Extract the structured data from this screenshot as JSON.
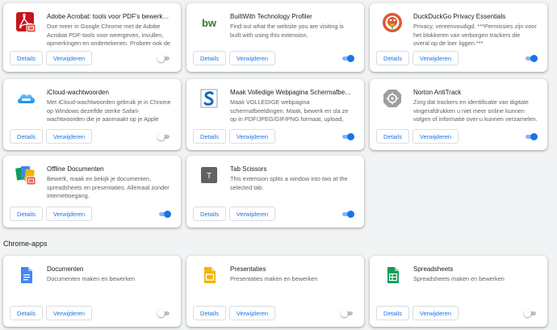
{
  "buttons": {
    "details": "Details",
    "remove": "Verwijderen"
  },
  "extensions": [
    {
      "name": "Adobe Acrobat: tools voor PDF's bewerken, co...",
      "description": "Doe meer in Google Chrome met de Adobe Acrobat PDF-tools voor weergeven, invullen, opmerkingen en ondertekenen. Probeer ook de",
      "enabled": false,
      "icon": "adobe-acrobat-icon"
    },
    {
      "name": "BuiltWith Technology Profiler",
      "description": "Find out what the website you are visiting is built with using this extension.",
      "enabled": true,
      "icon": "builtwith-icon",
      "icon_text": "bw"
    },
    {
      "name": "DuckDuckGo Privacy Essentials",
      "description": "Privacy, vereenvoudigd. ***Permissies zijn voor het blokkeren van verborgen trackers die overal op de loer liggen.***",
      "enabled": true,
      "icon": "duckduckgo-icon"
    },
    {
      "name": "iCloud-wachtwoorden",
      "description": "Met iCloud-wachtwoorden gebruik je in Chrome op Windows dezelfde sterke Safari-wachtwoorden die je aanmaakt op je Apple apparaat.",
      "enabled": false,
      "icon": "icloud-icon"
    },
    {
      "name": "Maak Volledige Webpagina Schermafbeelding...",
      "description": "Maak VOLLEDIGE webpagina schermafbeeldingen. Maak, bewerk en sla ze op in PDF/JPEG/GIF/PNG formaat, upload, druk af,",
      "enabled": true,
      "icon": "screenshot-icon"
    },
    {
      "name": "Norton AntiTrack",
      "description": "Zorg dat trackers en identificatie van digitale vingerafdrukken u niet meer online kunnen volgen of informatie over u kunnen verzamelen.",
      "enabled": true,
      "icon": "norton-antitrack-icon"
    },
    {
      "name": "Offline Documenten",
      "description": "Bewerk, maak en bekijk je documenten, spreadsheets en presentaties. Allemaal zonder internettoegang.",
      "enabled": true,
      "icon": "offline-docs-icon"
    },
    {
      "name": "Tab Scissors",
      "description": "This extension splits a window into two at the selected tab.",
      "enabled": true,
      "icon": "tab-scissors-icon",
      "icon_text": "T"
    }
  ],
  "chrome_apps": {
    "header": "Chrome-apps",
    "items": [
      {
        "name": "Documenten",
        "description": "Documenten maken en bewerken",
        "enabled": false,
        "icon": "google-docs-icon",
        "color": "#4285f4"
      },
      {
        "name": "Presentaties",
        "description": "Presentaties maken en bewerken",
        "enabled": false,
        "icon": "google-slides-icon",
        "color": "#f4b400"
      },
      {
        "name": "Spreadsheets",
        "description": "Spreadsheets maken en bewerken",
        "enabled": false,
        "icon": "google-sheets-icon",
        "color": "#0f9d58"
      }
    ]
  }
}
